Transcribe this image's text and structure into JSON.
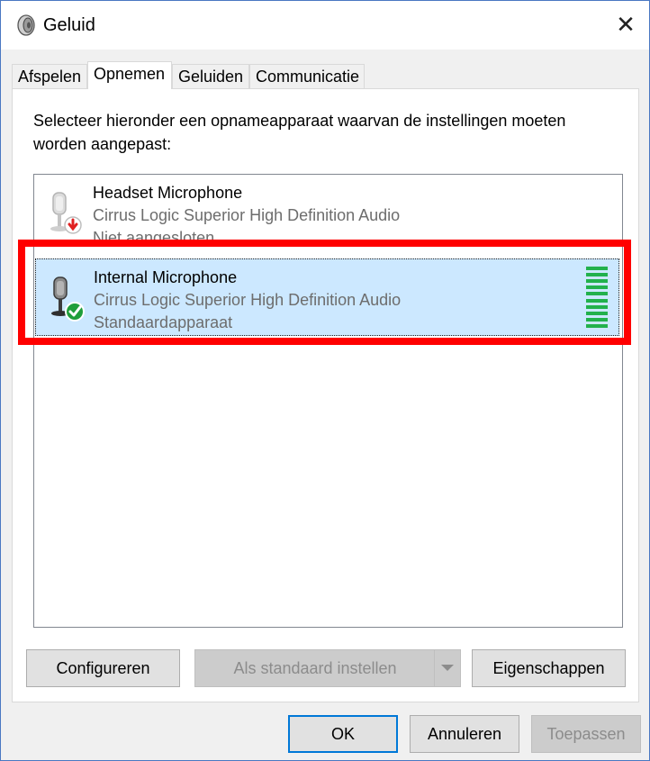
{
  "window": {
    "title": "Geluid",
    "app_icon": "speaker-icon",
    "close_glyph": "✕"
  },
  "tabs": [
    {
      "label": "Afspelen",
      "active": false
    },
    {
      "label": "Opnemen",
      "active": true
    },
    {
      "label": "Geluiden",
      "active": false
    },
    {
      "label": "Communicatie",
      "active": false
    }
  ],
  "panel": {
    "instruction": "Selecteer hieronder een opnameapparaat waarvan de instellingen moeten worden aangepast:"
  },
  "devices": [
    {
      "name": "Headset Microphone",
      "driver": "Cirrus Logic Superior High Definition Audio",
      "state": "Niet aangesloten",
      "icon": "microphone-disconnected-icon",
      "status_badge": "red-down-arrow",
      "selected": false
    },
    {
      "name": "Internal Microphone",
      "driver": "Cirrus Logic Superior High Definition Audio",
      "state": "Standaardapparaat",
      "icon": "microphone-default-icon",
      "status_badge": "green-check",
      "selected": true,
      "level_bars": 10
    }
  ],
  "buttons": {
    "configure": "Configureren",
    "set_default": "Als standaard instellen",
    "properties": "Eigenschappen",
    "ok": "OK",
    "cancel": "Annuleren",
    "apply": "Toepassen"
  },
  "colors": {
    "selection": "#cce8ff",
    "highlight_annotation": "#ff0000",
    "level_meter": "#22b14c",
    "default_button_border": "#0078d7"
  }
}
